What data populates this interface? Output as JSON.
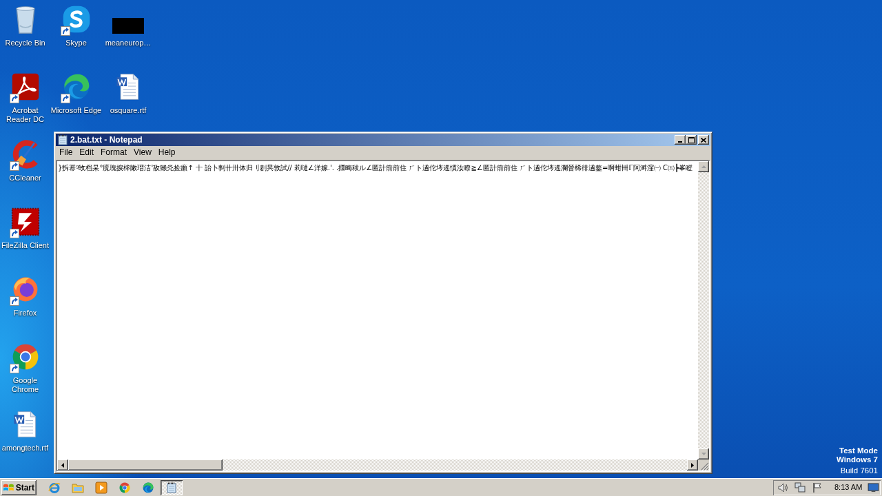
{
  "desktop_icons": [
    {
      "label": "Recycle Bin",
      "shortcut": false
    },
    {
      "label": "Skype",
      "shortcut": true
    },
    {
      "label": "meaneurop…",
      "shortcut": false
    },
    {
      "label": "Acrobat Reader DC",
      "shortcut": true
    },
    {
      "label": "Microsoft Edge",
      "shortcut": true
    },
    {
      "label": "osquare.rtf",
      "shortcut": false
    },
    {
      "label": "CCleaner",
      "shortcut": true
    },
    {
      "label": "FileZilla Client",
      "shortcut": true
    },
    {
      "label": "Firefox",
      "shortcut": true
    },
    {
      "label": "Google Chrome",
      "shortcut": true
    },
    {
      "label": "amongtech.rtf",
      "shortcut": false
    }
  ],
  "window": {
    "title": "2.bat.txt - Notepad",
    "menu": [
      "File",
      "Edit",
      "Format",
      "View",
      "Help"
    ],
    "content": "}拆幂ᵍ敀档杲°䐠瑰捩桳敶瑨洁'敌獭灮捡癩↑ 十 詒卜剚卄卅体归刂剨昗敦試// 莉嗹∠洋嫁.'. .攌畮秡ル∠匿計箭前住 ㄏト遹佗埁遙慣汝瞭≧∠匿計箭前住 ㄏト遹佗埁遙瀾晉桸徘遹鏊=啊蚶卌ℾ阿溿漥㈠ C㈤┣峯瞪"
  },
  "os_notice": [
    "Test Mode",
    "Windows 7",
    "Build 7601"
  ],
  "taskbar": {
    "start": "Start",
    "tasks": [
      {
        "selected": true
      }
    ],
    "clock": "8:13 AM"
  }
}
